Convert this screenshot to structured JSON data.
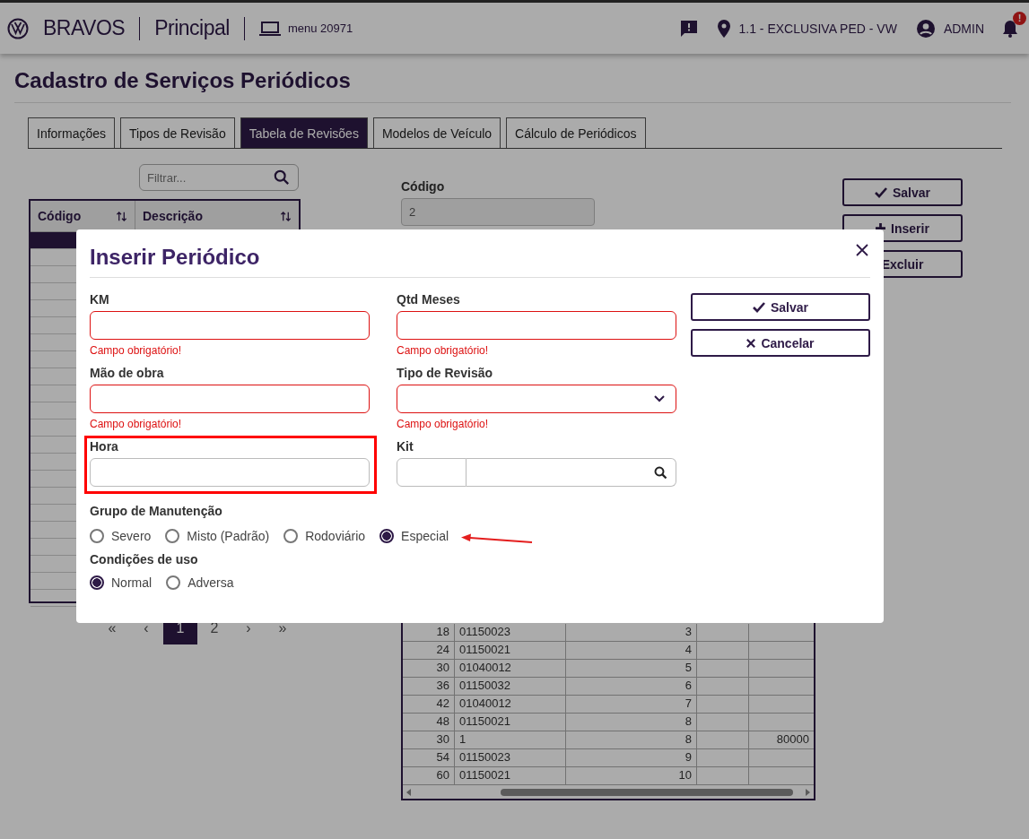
{
  "topbar": {
    "brand": "BRAVOS",
    "module": "Principal",
    "menu": "menu 20971",
    "location": "1.1 - EXCLUSIVA PED - VW",
    "user": "ADMIN",
    "notification_badge": "!"
  },
  "page": {
    "title": "Cadastro de Serviços Periódicos"
  },
  "tabs": [
    {
      "label": "Informações",
      "selected": false
    },
    {
      "label": "Tipos de Revisão",
      "selected": false
    },
    {
      "label": "Tabela de Revisões",
      "selected": true
    },
    {
      "label": "Modelos de Veículo",
      "selected": false
    },
    {
      "label": "Cálculo de Periódicos",
      "selected": false
    }
  ],
  "list": {
    "filter_placeholder": "Filtrar...",
    "columns": [
      "Código",
      "Descrição"
    ],
    "rows": [
      {
        "selected": true
      },
      {
        "selected": false
      },
      {
        "selected": false
      },
      {
        "selected": false
      },
      {
        "selected": false
      },
      {
        "selected": false
      },
      {
        "selected": false
      },
      {
        "selected": false
      },
      {
        "selected": false
      },
      {
        "selected": false
      },
      {
        "selected": false
      },
      {
        "selected": false
      },
      {
        "selected": false
      },
      {
        "selected": false
      },
      {
        "selected": false
      },
      {
        "selected": false
      },
      {
        "selected": false
      },
      {
        "selected": false
      },
      {
        "selected": false
      },
      {
        "selected": false
      },
      {
        "selected": false
      },
      {
        "selected": false
      }
    ]
  },
  "pagination": [
    {
      "label": "«",
      "selected": false
    },
    {
      "label": "‹",
      "selected": false
    },
    {
      "label": "1",
      "selected": true
    },
    {
      "label": "2",
      "selected": false
    },
    {
      "label": "›",
      "selected": false
    },
    {
      "label": "»",
      "selected": false
    }
  ],
  "detail": {
    "code_label": "Código",
    "code_value": "2"
  },
  "actions": [
    {
      "label": "Salvar"
    },
    {
      "label": "Inserir"
    },
    {
      "label": "Excluir"
    }
  ],
  "revisions_table": {
    "rows": [
      {
        "column_1": "18",
        "column_2": "01150023",
        "column_3": "3"
      },
      {
        "column_1": "24",
        "column_2": "01150021",
        "column_3": "4"
      },
      {
        "column_1": "30",
        "column_2": "01040012",
        "column_3": "5"
      },
      {
        "column_1": "36",
        "column_2": "01150032",
        "column_3": "6"
      },
      {
        "column_1": "42",
        "column_2": "01040012",
        "column_3": "7"
      },
      {
        "column_1": "48",
        "column_2": "01150021",
        "column_3": "8"
      },
      {
        "column_1": "30",
        "column_2": "1",
        "column_3": "8",
        "column_5": "80000"
      },
      {
        "column_1": "54",
        "column_2": "01150023",
        "column_3": "9"
      },
      {
        "column_1": "60",
        "column_2": "01150021",
        "column_3": "10"
      }
    ]
  },
  "modal": {
    "title": "Inserir Periódico",
    "fields": [
      {
        "label": "KM",
        "kind": "text",
        "error": "Campo obrigatório!",
        "highlighted": false
      },
      {
        "label": "Qtd Meses",
        "kind": "text",
        "error": "Campo obrigatório!",
        "highlighted": false
      },
      {
        "label": "Mão de obra",
        "kind": "text",
        "error": "Campo obrigatório!",
        "highlighted": false
      },
      {
        "label": "Tipo de Revisão",
        "kind": "select",
        "error": "Campo obrigatório!",
        "highlighted": false
      },
      {
        "label": "Hora",
        "kind": "text",
        "highlighted": true
      },
      {
        "label": "Kit",
        "kind": "lookup",
        "highlighted": false
      }
    ],
    "groups": [
      {
        "label": "Grupo de Manutenção",
        "options": [
          {
            "label": "Severo",
            "selected": false,
            "pointed": false
          },
          {
            "label": "Misto (Padrão)",
            "selected": false,
            "pointed": false
          },
          {
            "label": "Rodoviário",
            "selected": false,
            "pointed": false
          },
          {
            "label": "Especial",
            "selected": true,
            "pointed": true
          }
        ]
      },
      {
        "label": "Condições de uso",
        "options": [
          {
            "label": "Normal",
            "selected": true,
            "pointed": false
          },
          {
            "label": "Adversa",
            "selected": false,
            "pointed": false
          }
        ]
      }
    ],
    "buttons": [
      {
        "label": "Salvar"
      },
      {
        "label": "Cancelar"
      }
    ]
  }
}
